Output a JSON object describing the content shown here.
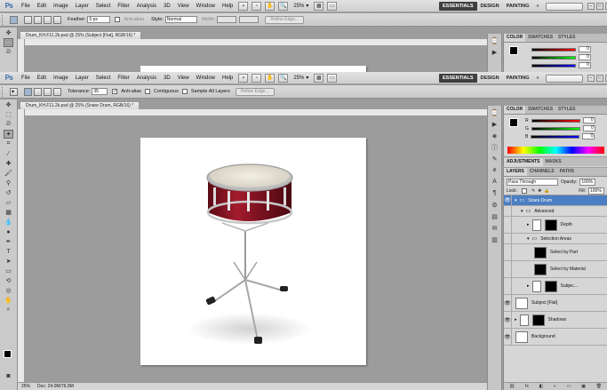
{
  "menus": [
    "File",
    "Edit",
    "Image",
    "Layer",
    "Select",
    "Filter",
    "Analysis",
    "3D",
    "View",
    "Window",
    "Help"
  ],
  "zoom": "25%",
  "workspaces": {
    "essentials": "ESSENTIALS",
    "design": "DESIGN",
    "painting": "PAINTING",
    "more": "»"
  },
  "app_logo": "Ps",
  "back_window": {
    "options": {
      "feather_label": "Feather:",
      "feather_value": "0 px",
      "antialias": "Anti-alias",
      "style_label": "Style:",
      "style_value": "Normal",
      "width_label": "Width:",
      "refine": "Refine Edge..."
    },
    "doc_tab": "Drum_KH.F11.2k.psd @ 25% (Subject [Flat], RGB/16) *",
    "color_tabs": [
      "COLOR",
      "SWATCHES",
      "STYLES"
    ],
    "rgb_values": [
      "0",
      "0",
      "0"
    ]
  },
  "front_window": {
    "options": {
      "tolerance_label": "Tolerance:",
      "tolerance_value": "35",
      "antialias": "Anti-alias",
      "contiguous": "Contiguous",
      "sample_all": "Sample All Layers",
      "refine": "Refine Edge..."
    },
    "doc_tab": "Drum_KH.F11.2k.psd @ 25% (Snare Drum, RGB/16) *",
    "color_tabs": [
      "COLOR",
      "SWATCHES",
      "STYLES"
    ],
    "rgb_labels": [
      "R",
      "G",
      "B"
    ],
    "rgb_values": [
      "0",
      "0",
      "0"
    ],
    "adj_tabs": [
      "ADJUSTMENTS",
      "MASKS"
    ],
    "layers_tabs": [
      "LAYERS",
      "CHANNELS",
      "PATHS"
    ],
    "blend_mode": "Pass Through",
    "opacity_label": "Opacity:",
    "opacity_value": "100%",
    "lock_label": "Lock:",
    "fill_label": "Fill:",
    "fill_value": "100%",
    "layers": [
      {
        "name": "Snare Drum",
        "kind": "folder",
        "indent": 0,
        "selected": true,
        "visible": true,
        "open": true
      },
      {
        "name": "Advanced",
        "kind": "folder",
        "indent": 1,
        "selected": false,
        "visible": false,
        "open": true
      },
      {
        "name": "Depth",
        "kind": "layer-mask",
        "indent": 2,
        "selected": false,
        "visible": false
      },
      {
        "name": "Selection Areas",
        "kind": "folder",
        "indent": 2,
        "selected": false,
        "visible": false,
        "open": true
      },
      {
        "name": "Select by Part",
        "kind": "mask",
        "indent": 3,
        "selected": false,
        "visible": false
      },
      {
        "name": "Select by Material",
        "kind": "mask",
        "indent": 3,
        "selected": false,
        "visible": false
      },
      {
        "name": "Subjec...",
        "kind": "layer-mask",
        "indent": 2,
        "selected": false,
        "visible": false
      },
      {
        "name": "Subject [Flat]",
        "kind": "layer",
        "indent": 0,
        "selected": false,
        "visible": true
      },
      {
        "name": "Shadows",
        "kind": "layer-mask",
        "indent": 0,
        "selected": false,
        "visible": true
      },
      {
        "name": "Background",
        "kind": "layer",
        "indent": 0,
        "selected": false,
        "visible": true
      }
    ],
    "status": {
      "zoom": "25%",
      "doc": "Doc: 24.0M/76.9M"
    }
  },
  "colors": {
    "selection": "#4b7ec2",
    "essentials_bg": "#3f3f3f",
    "drum_red": "#8e1526"
  }
}
